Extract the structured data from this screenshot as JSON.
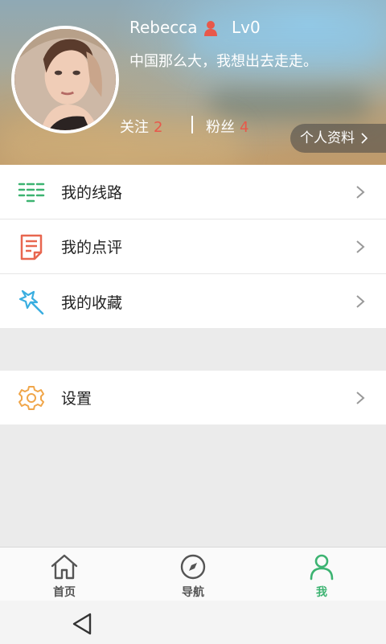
{
  "profile": {
    "username": "Rebecca",
    "level": "Lv0",
    "signature": "中国那么大，我想出去走走。",
    "follow_label": "关注",
    "follow_count": "2",
    "fans_label": "粉丝",
    "fans_count": "4",
    "profile_button": "个人资料",
    "gender_icon": "user-female-icon"
  },
  "menu": {
    "items": [
      {
        "label": "我的线路",
        "icon": "route-list-icon",
        "color": "#3cb371"
      },
      {
        "label": "我的点评",
        "icon": "review-note-icon",
        "color": "#e8664f"
      },
      {
        "label": "我的收藏",
        "icon": "favorite-star-wand-icon",
        "color": "#3aaee0"
      }
    ],
    "settings": {
      "label": "设置",
      "icon": "gear-icon",
      "color": "#f0a64a"
    }
  },
  "tabs": [
    {
      "label": "首页",
      "icon": "home-icon",
      "active": false
    },
    {
      "label": "导航",
      "icon": "compass-icon",
      "active": false
    },
    {
      "label": "我",
      "icon": "user-icon",
      "active": true
    }
  ],
  "colors": {
    "accent_green": "#3cb371",
    "count_red": "#e8584a",
    "background_gray": "#ebebeb"
  }
}
